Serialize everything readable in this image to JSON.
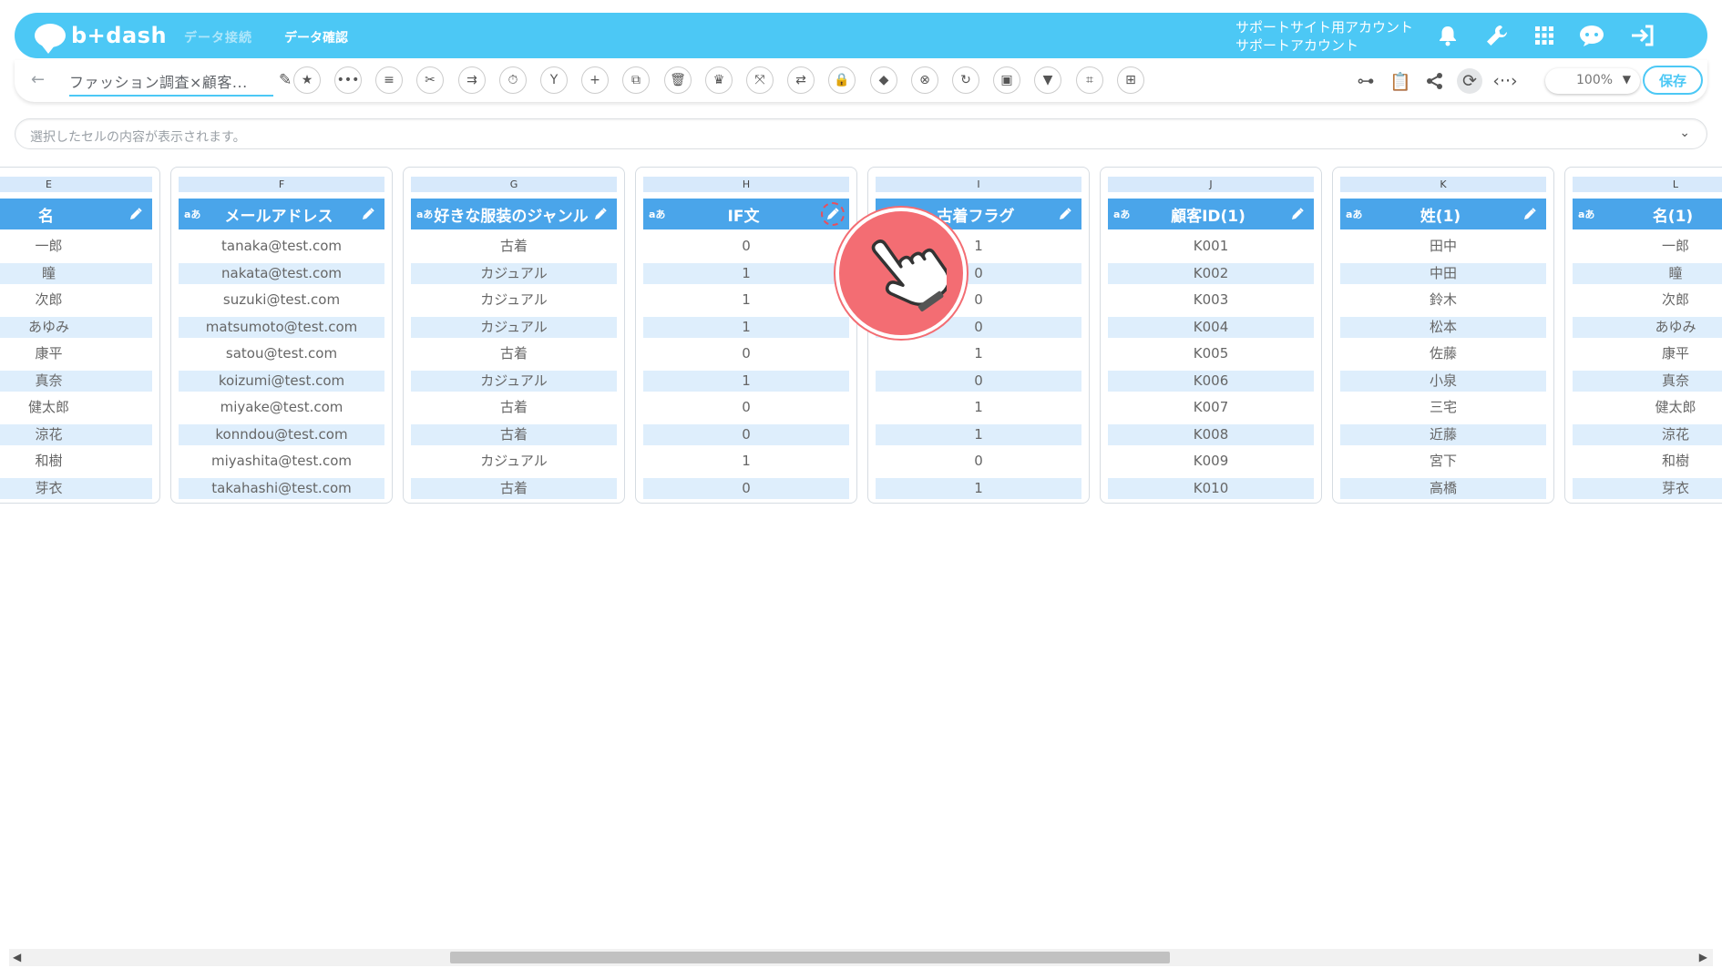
{
  "topbar": {
    "logo_text": "b+dash",
    "nav_link_1": "データ接続",
    "nav_link_2": "データ確認",
    "account_line_1": "サポートサイト用アカウント",
    "account_line_2": "サポートアカウント",
    "icons": [
      "bell-icon",
      "wrench-icon",
      "apps-grid-icon",
      "chatbot-icon",
      "logout-icon"
    ]
  },
  "toolbar": {
    "filename": "ファッション調査×顧客...",
    "save_label": "保存",
    "zoom_value": "100%",
    "tools": [
      "star-icon",
      "more-icon",
      "list-icon",
      "scissors-icon",
      "merge-icon",
      "timer-icon",
      "branch-icon",
      "plus-icon",
      "copy-icon",
      "trash-icon",
      "crown-icon",
      "expand-icon",
      "swap-icon",
      "lock-icon",
      "package-icon",
      "cancel-icon",
      "refresh-icon",
      "frame-icon",
      "filter-icon",
      "pivot-icon",
      "table-icon"
    ],
    "right_tools": [
      "flow-icon",
      "clipboard-icon",
      "share-icon",
      "history-icon",
      "code-icon"
    ]
  },
  "cellinfo": {
    "placeholder": "選択したセルの内容が表示されます。"
  },
  "colors": {
    "topbar": "#4cc8f5",
    "header": "#4aa5ea",
    "row_alt": "#deeefc",
    "hand": "#f36d73"
  },
  "columns": [
    {
      "letter": "E",
      "type": "",
      "name": "名",
      "values": [
        "一郎",
        "瞳",
        "次郎",
        "あゆみ",
        "康平",
        "真奈",
        "健太郎",
        "涼花",
        "和樹",
        "芽衣"
      ]
    },
    {
      "letter": "F",
      "type": "aあ",
      "name": "メールアドレス",
      "values": [
        "tanaka@test.com",
        "nakata@test.com",
        "suzuki@test.com",
        "matsumoto@test.com",
        "satou@test.com",
        "koizumi@test.com",
        "miyake@test.com",
        "konndou@test.com",
        "miyashita@test.com",
        "takahashi@test.com"
      ]
    },
    {
      "letter": "G",
      "type": "aあ",
      "name": "好きな服装のジャンル",
      "values": [
        "古着",
        "カジュアル",
        "カジュアル",
        "カジュアル",
        "古着",
        "カジュアル",
        "古着",
        "古着",
        "カジュアル",
        "古着"
      ]
    },
    {
      "letter": "H",
      "type": "aあ",
      "name": "IF文",
      "values": [
        "0",
        "1",
        "1",
        "1",
        "0",
        "1",
        "0",
        "0",
        "1",
        "0"
      ]
    },
    {
      "letter": "I",
      "type": "",
      "name": "古着フラグ",
      "values": [
        "1",
        "0",
        "0",
        "0",
        "1",
        "0",
        "1",
        "1",
        "0",
        "1"
      ]
    },
    {
      "letter": "J",
      "type": "aあ",
      "name": "顧客ID(1)",
      "values": [
        "K001",
        "K002",
        "K003",
        "K004",
        "K005",
        "K006",
        "K007",
        "K008",
        "K009",
        "K010"
      ]
    },
    {
      "letter": "K",
      "type": "aあ",
      "name": "姓(1)",
      "values": [
        "田中",
        "中田",
        "鈴木",
        "松本",
        "佐藤",
        "小泉",
        "三宅",
        "近藤",
        "宮下",
        "高橋"
      ]
    },
    {
      "letter": "L",
      "type": "aあ",
      "name": "名(1)",
      "values": [
        "一郎",
        "瞳",
        "次郎",
        "あゆみ",
        "康平",
        "真奈",
        "健太郎",
        "涼花",
        "和樹",
        "芽衣"
      ]
    }
  ]
}
